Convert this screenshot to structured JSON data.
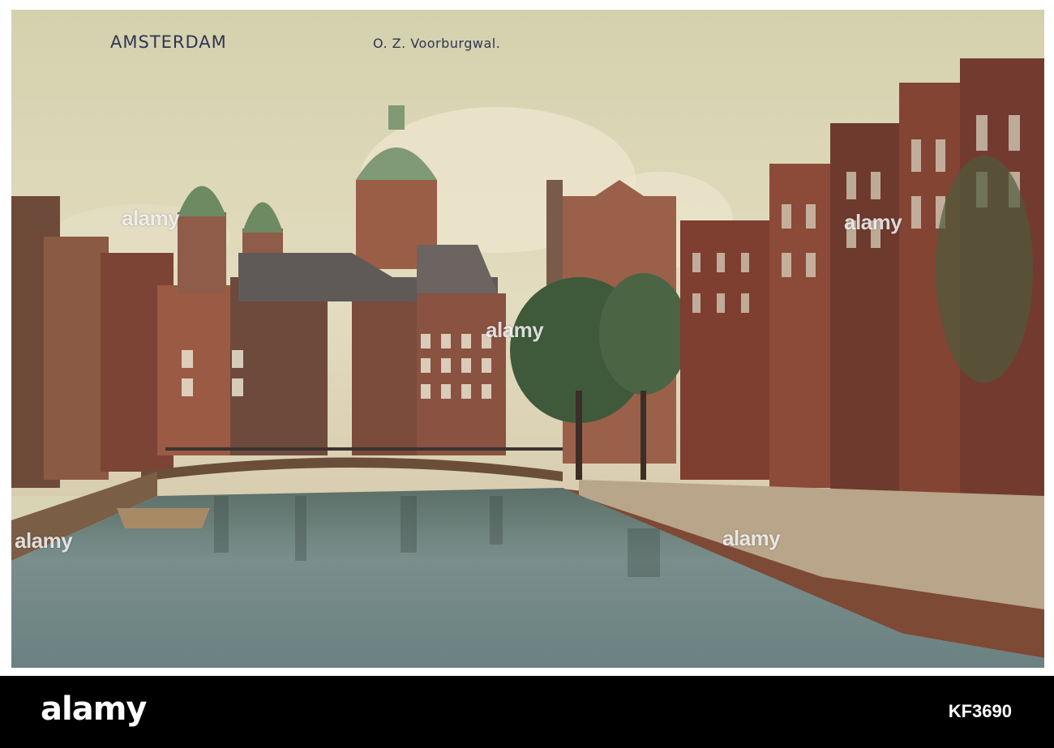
{
  "postcard": {
    "caption_city": "AMSTERDAM",
    "caption_street": "O. Z. Voorburgwal."
  },
  "watermarks": [
    "alamy",
    "alamy",
    "alamy",
    "alamy",
    "alamy"
  ],
  "footer": {
    "logo": "alamy",
    "image_id": "KF3690"
  },
  "colors": {
    "sky": "#d6d3b2",
    "brick": "#8a4a35",
    "dome": "#7f9a74",
    "water": "#6f8785",
    "footer": "#000000"
  }
}
